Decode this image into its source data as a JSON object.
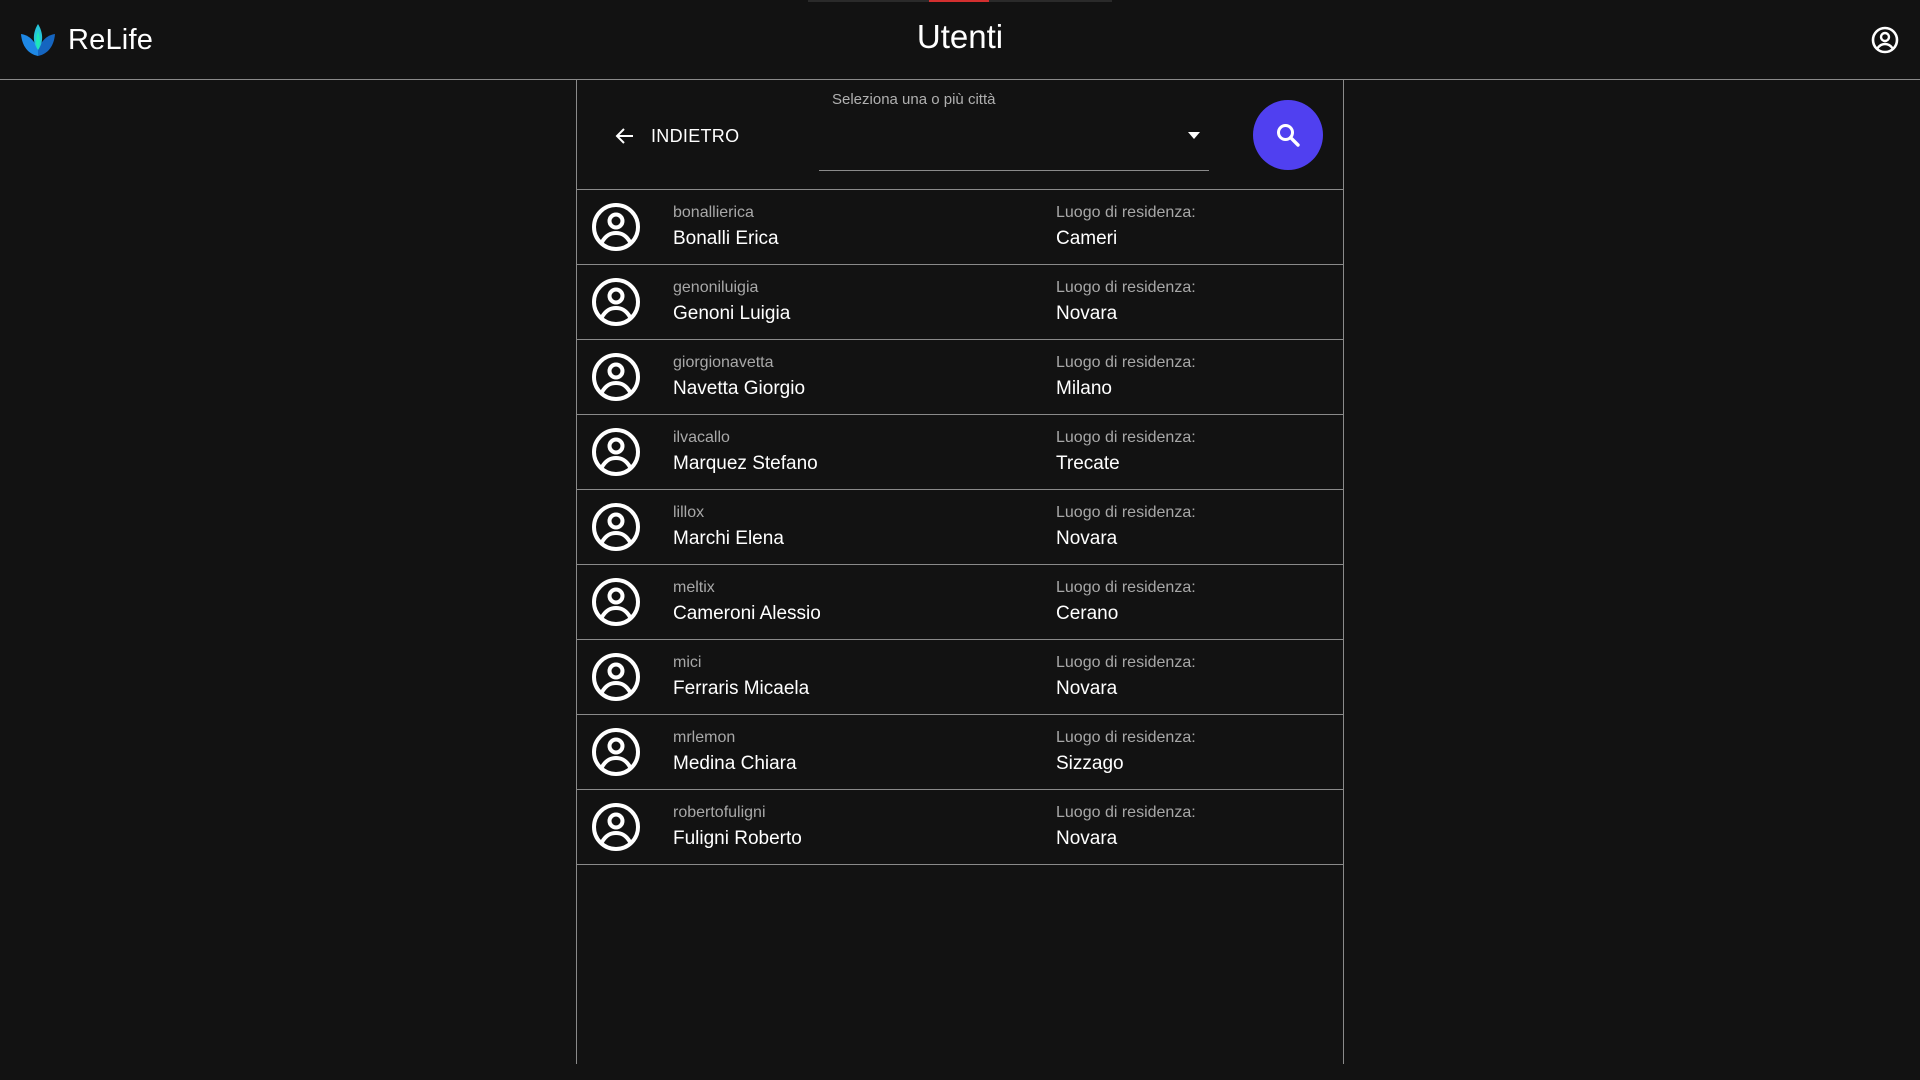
{
  "app": {
    "brand_name": "ReLife",
    "page_title": "Utenti",
    "brand_colors": [
      "#1e88e5",
      "#26c6da",
      "#1de9b6"
    ],
    "account_icon": "account-circle-icon"
  },
  "toolbar": {
    "back_label": "INDIETRO",
    "back_icon": "arrow-left-icon",
    "city_filter": {
      "label": "Seleziona una o più città",
      "value": "",
      "icon": "dropdown-arrow-icon"
    },
    "search_icon": "search-icon",
    "search_color": "#5040f0"
  },
  "users": [
    {
      "username": "bonallierica",
      "name": "Bonalli Erica",
      "residence_label": "Luogo di residenza:",
      "city": "Cameri"
    },
    {
      "username": "genoniluigia",
      "name": "Genoni Luigia",
      "residence_label": "Luogo di residenza:",
      "city": "Novara"
    },
    {
      "username": "giorgionavetta",
      "name": "Navetta Giorgio",
      "residence_label": "Luogo di residenza:",
      "city": "Milano"
    },
    {
      "username": "ilvacallo",
      "name": "Marquez Stefano",
      "residence_label": "Luogo di residenza:",
      "city": "Trecate"
    },
    {
      "username": "lillox",
      "name": "Marchi Elena",
      "residence_label": "Luogo di residenza:",
      "city": "Novara"
    },
    {
      "username": "meltix",
      "name": "Cameroni Alessio",
      "residence_label": "Luogo di residenza:",
      "city": "Cerano"
    },
    {
      "username": "mici",
      "name": "Ferraris Micaela",
      "residence_label": "Luogo di residenza:",
      "city": "Novara"
    },
    {
      "username": "mrlemon",
      "name": "Medina Chiara",
      "residence_label": "Luogo di residenza:",
      "city": "Sizzago"
    },
    {
      "username": "robertofuligni",
      "name": "Fuligni Roberto",
      "residence_label": "Luogo di residenza:",
      "city": "Novara"
    }
  ]
}
